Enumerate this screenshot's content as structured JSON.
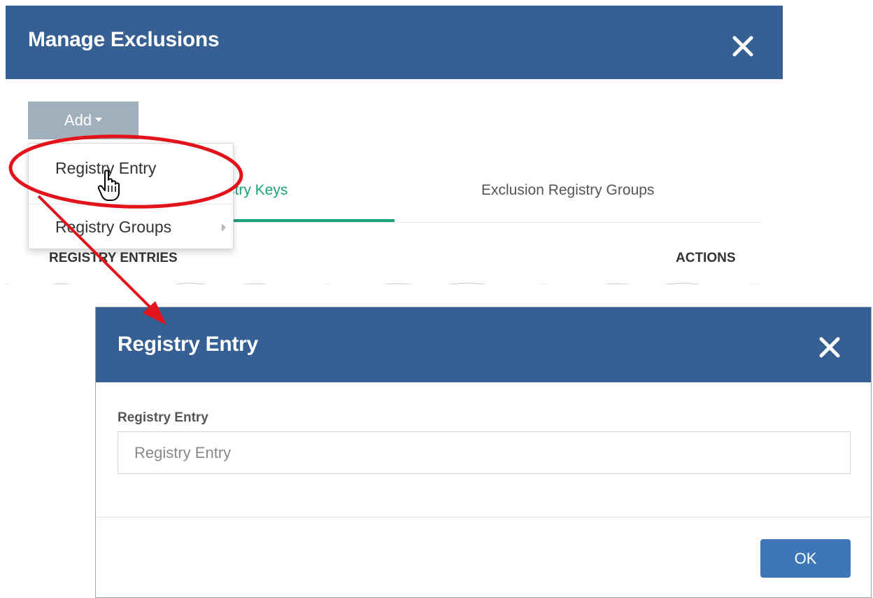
{
  "manage_dialog": {
    "title": "Manage Exclusions",
    "add_button_label": "Add",
    "tabs": [
      {
        "label": "Exclusion Registry Keys",
        "visible_fragment": "stry Keys",
        "active": true
      },
      {
        "label": "Exclusion Registry Groups",
        "active": false
      }
    ],
    "columns": {
      "entries": "REGISTRY ENTRIES",
      "actions": "ACTIONS"
    },
    "dropdown": {
      "items": [
        {
          "label": "Registry Entry"
        },
        {
          "label": "Registry Groups",
          "has_submenu": true
        }
      ]
    }
  },
  "registry_dialog": {
    "title": "Registry Entry",
    "field_label": "Registry Entry",
    "field_placeholder": "Registry Entry",
    "field_value": "",
    "ok_label": "OK"
  },
  "icons": {
    "close": "close-icon",
    "caret": "caret-down-icon",
    "submenu": "chevron-right-icon",
    "cursor": "hand-pointer-icon"
  },
  "colors": {
    "header_blue": "#366093",
    "active_tab_green": "#1aa17a",
    "ok_button_blue": "#3e76b7",
    "add_button_gray": "#a2afbd",
    "annotation_red": "#e3131b"
  }
}
